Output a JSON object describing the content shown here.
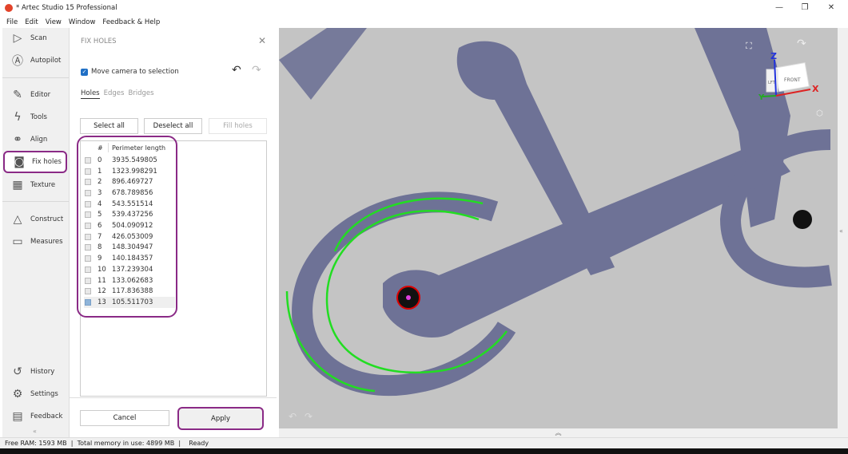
{
  "app": {
    "title": "* Artec Studio 15 Professional",
    "minimize": "—",
    "restore": "❐",
    "close": "✕"
  },
  "menu": [
    "File",
    "Edit",
    "View",
    "Window",
    "Feedback & Help"
  ],
  "sidebar": {
    "items": [
      {
        "label": "Scan",
        "icon": "play-triangle-icon"
      },
      {
        "label": "Autopilot",
        "icon": "autopilot-icon"
      },
      {
        "label": "Editor",
        "icon": "pencil-icon"
      },
      {
        "label": "Tools",
        "icon": "lightning-icon"
      },
      {
        "label": "Align",
        "icon": "align-icon"
      },
      {
        "label": "Fix holes",
        "icon": "fix-holes-icon",
        "active": true
      },
      {
        "label": "Texture",
        "icon": "texture-icon"
      },
      {
        "label": "Construct",
        "icon": "triangle-icon"
      },
      {
        "label": "Measures",
        "icon": "ruler-icon"
      },
      {
        "label": "History",
        "icon": "history-icon"
      },
      {
        "label": "Settings",
        "icon": "gear-icon"
      },
      {
        "label": "Feedback",
        "icon": "comment-icon"
      }
    ],
    "collapse": "«"
  },
  "panel": {
    "title": "FIX HOLES",
    "move_camera_label": "Move camera to selection",
    "move_camera_checked": true,
    "tabs": [
      "Holes",
      "Edges",
      "Bridges"
    ],
    "active_tab": "Holes",
    "select_all": "Select all",
    "deselect_all": "Deselect all",
    "fill_holes": "Fill holes",
    "columns": [
      "#",
      "Perimeter length"
    ],
    "holes": [
      {
        "id": "0",
        "perimeter": "3935.549805"
      },
      {
        "id": "1",
        "perimeter": "1323.998291"
      },
      {
        "id": "2",
        "perimeter": "896.469727"
      },
      {
        "id": "3",
        "perimeter": "678.789856"
      },
      {
        "id": "4",
        "perimeter": "543.551514"
      },
      {
        "id": "5",
        "perimeter": "539.437256"
      },
      {
        "id": "6",
        "perimeter": "504.090912"
      },
      {
        "id": "7",
        "perimeter": "426.053009"
      },
      {
        "id": "8",
        "perimeter": "148.304947"
      },
      {
        "id": "9",
        "perimeter": "140.184357"
      },
      {
        "id": "10",
        "perimeter": "137.239304"
      },
      {
        "id": "11",
        "perimeter": "133.062683"
      },
      {
        "id": "12",
        "perimeter": "117.836388"
      },
      {
        "id": "13",
        "perimeter": "105.511703",
        "selected": true
      }
    ],
    "cancel": "Cancel",
    "apply": "Apply"
  },
  "viewport": {
    "cube_front": "FRONT",
    "cube_left": "LFT",
    "axis_x": "X",
    "axis_y": "Y",
    "axis_z": "Z",
    "expand": "«",
    "collapse_bottom": "︽"
  },
  "status": {
    "free_ram": "Free RAM: 1593 MB",
    "sep": "|",
    "total_memory": "Total memory in use: 4899 MB",
    "state": "Ready"
  },
  "colors": {
    "accent": "#8a2a86",
    "model": "#6e7296",
    "hole_edge": "#22dd22",
    "viewport": "#c4c4c4"
  }
}
